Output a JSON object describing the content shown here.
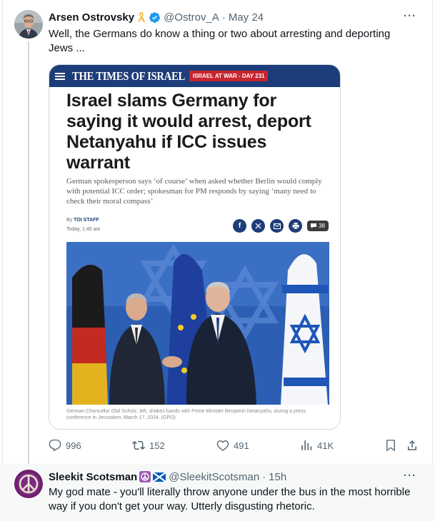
{
  "tweet": {
    "author_name": "Arsen Ostrovsky",
    "author_handle": "@Ostrov_A",
    "separator": "·",
    "date": "May 24",
    "more": "···",
    "text": "Well, the Germans do know a thing or two about arresting and deporting Jews ...",
    "stats": {
      "replies": "996",
      "reposts": "152",
      "likes": "491",
      "views": "41K"
    }
  },
  "article": {
    "masthead": "THE TIMES OF ISRAEL",
    "section_pill": "ISRAEL AT WAR - DAY 231",
    "headline": "Israel slams Germany for saying it would arrest, deport Netanyahu if ICC issues warrant",
    "subhead": "German spokesperson says ‘of course’ when asked whether Berlin would comply with potential ICC order; spokesman for PM responds by saying ‘many need to check their moral compass’",
    "by_prefix": "By",
    "author": "TOI STAFF",
    "dateline": "Today, 1:40 am",
    "comment_count": "38",
    "share_icons": [
      "facebook-icon",
      "x-icon",
      "email-icon",
      "print-icon"
    ],
    "caption": "German Chancellor Olaf Scholz, left, shakes hands with Prime Minister Benjamin Netanyahu, during a press conference in Jerusalem, March 17, 2024. (GPO)"
  },
  "reply": {
    "author_name": "Sleekit Scotsman",
    "author_handle": "@SleekitScotsman",
    "separator": "·",
    "date": "15h",
    "more": "···",
    "text": "My god mate - you'll literally throw anyone under the bus in the most horrible way if you don't get your way. Utterly disgusting rhetoric."
  },
  "colors": {
    "verified_blue": "#1d9bf0",
    "toi_navy": "#1d3d7a",
    "toi_red": "#c8252f",
    "secondary_text": "#536471"
  }
}
